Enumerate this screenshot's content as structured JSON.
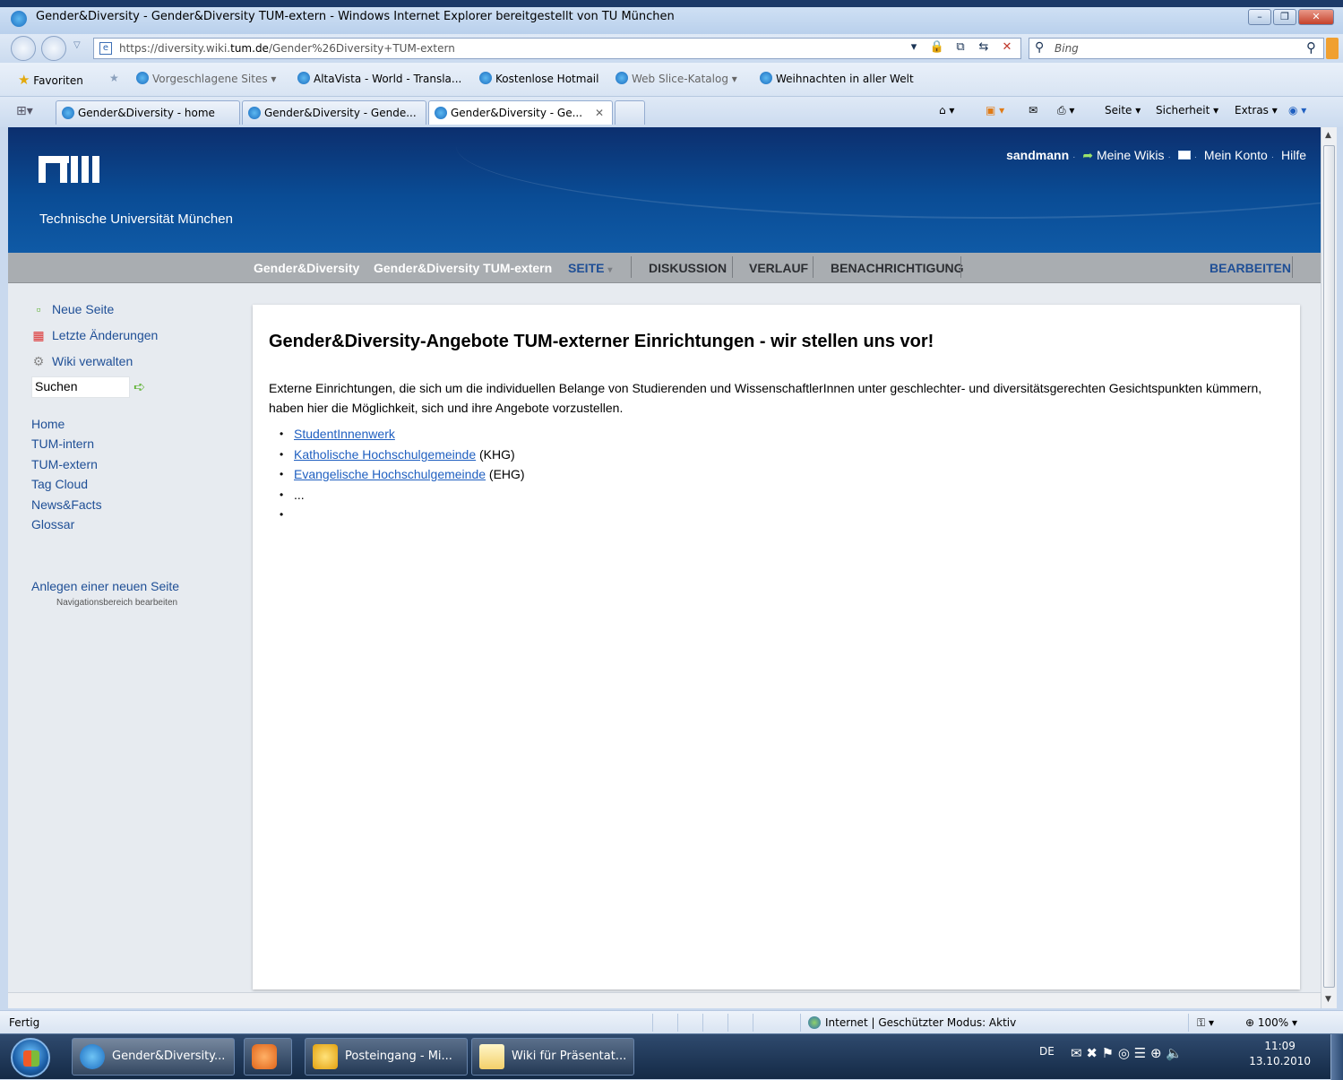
{
  "window": {
    "title": "Gender&Diversity - Gender&Diversity TUM-extern - Windows Internet Explorer bereitgestellt von TU München"
  },
  "address": {
    "url_prefix": "https://diversity.wiki.",
    "url_domain": "tum.de",
    "url_path": "/Gender%26Diversity+TUM-extern",
    "search_placeholder": "Bing"
  },
  "favorites": {
    "label": "Favoriten",
    "items": [
      "Vorgeschlagene Sites ▾",
      "AltaVista - World - Transla...",
      "Kostenlose Hotmail",
      "Web Slice-Katalog ▾",
      "Weihnachten in aller Welt"
    ]
  },
  "tabs": [
    {
      "label": "Gender&Diversity - home"
    },
    {
      "label": "Gender&Diversity - Gende..."
    },
    {
      "label": "Gender&Diversity - Ge..."
    }
  ],
  "commandbar": {
    "page": "Seite ▾",
    "security": "Sicherheit ▾",
    "extras": "Extras ▾"
  },
  "site": {
    "logo_text": "Technische Universität München",
    "user": "sandmann",
    "my_wikis": "Meine Wikis",
    "my_account": "Mein Konto",
    "help": "Hilfe"
  },
  "nav": {
    "crumb1": "Gender&Diversity",
    "crumb2": "Gender&Diversity TUM-extern",
    "page": "SEITE",
    "discussion": "DISKUSSION",
    "history": "VERLAUF",
    "notification": "BENACHRICHTIGUNG",
    "edit": "BEARBEITEN"
  },
  "sidebar": {
    "tools": [
      "Neue Seite",
      "Letzte Änderungen",
      "Wiki verwalten"
    ],
    "search_value": "Suchen",
    "links": [
      "Home",
      "TUM-intern",
      "TUM-extern",
      "Tag Cloud",
      "News&Facts",
      "Glossar"
    ],
    "create_page": "Anlegen einer neuen Seite",
    "edit_nav": "Navigationsbereich bearbeiten"
  },
  "content": {
    "heading": "Gender&Diversity-Angebote TUM-externer Einrichtungen - wir stellen uns vor!",
    "paragraph": "Externe Einrichtungen, die sich um die individuellen Belange von Studierenden und WissenschaftlerInnen unter geschlechter- und diversitätsgerechten Gesichtspunkten kümmern, haben hier die Möglichkeit, sich und ihre Angebote vorzustellen.",
    "list": [
      {
        "link": "StudentInnenwerk",
        "suffix": ""
      },
      {
        "link": "Katholische Hochschulgemeinde",
        "suffix": " (KHG)"
      },
      {
        "link": "Evangelische Hochschulgemeinde",
        "suffix": " (EHG)"
      },
      {
        "link": "",
        "suffix": "..."
      },
      {
        "link": "",
        "suffix": ""
      }
    ]
  },
  "status": {
    "left": "Fertig",
    "zone": "Internet | Geschützter Modus: Aktiv",
    "zoom": "100%"
  },
  "taskbar": {
    "items": [
      "Gender&Diversity...",
      "Posteingang - Mi...",
      "Wiki für Präsentat..."
    ],
    "lang": "DE",
    "time": "11:09",
    "date": "13.10.2010"
  }
}
